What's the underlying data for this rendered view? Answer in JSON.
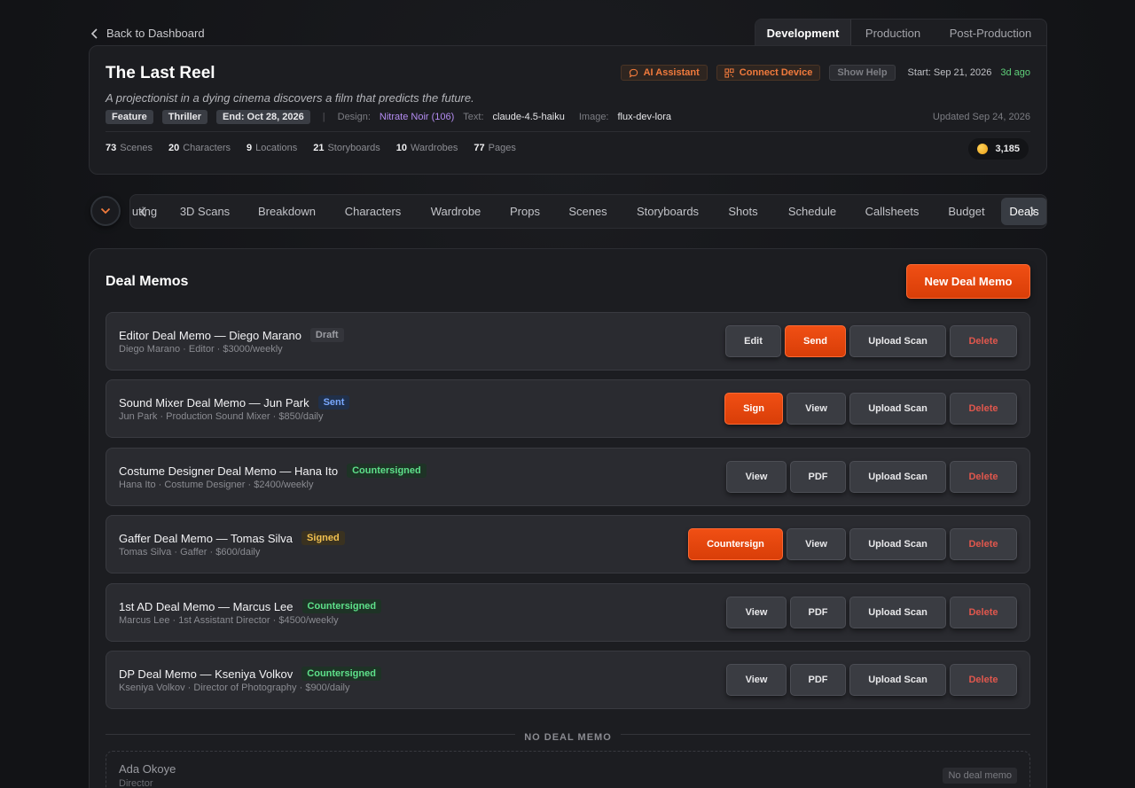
{
  "nav": {
    "back_label": "Back to Dashboard"
  },
  "phase_tabs": [
    {
      "label": "Development",
      "active": true
    },
    {
      "label": "Production",
      "active": false
    },
    {
      "label": "Post-Production",
      "active": false
    }
  ],
  "project": {
    "title": "The Last Reel",
    "logline": "A projectionist in a dying cinema discovers a film that predicts the future.",
    "tags": [
      "Feature",
      "Thriller",
      "End: Oct 28, 2026"
    ],
    "separator": "|",
    "design_label": "Design:",
    "design_value": "Nitrate Noir (106)",
    "text_label": "Text:",
    "text_value": "claude-4.5-haiku",
    "image_label": "Image:",
    "image_value": "flux-dev-lora",
    "updated": "Updated Sep 24, 2026",
    "ai_assistant_label": "AI Assistant",
    "connect_device_label": "Connect Device",
    "show_help_label": "Show Help",
    "start_date": "Start: Sep 21, 2026",
    "ago": "3d ago",
    "stats": [
      {
        "num": "73",
        "label": "Scenes"
      },
      {
        "num": "20",
        "label": "Characters"
      },
      {
        "num": "9",
        "label": "Locations"
      },
      {
        "num": "21",
        "label": "Storyboards"
      },
      {
        "num": "10",
        "label": "Wardrobes"
      },
      {
        "num": "77",
        "label": "Pages"
      }
    ],
    "credits": "3,185"
  },
  "section_tabs": [
    {
      "label": "uting",
      "active": false
    },
    {
      "label": "3D Scans",
      "active": false
    },
    {
      "label": "Breakdown",
      "active": false
    },
    {
      "label": "Characters",
      "active": false
    },
    {
      "label": "Wardrobe",
      "active": false
    },
    {
      "label": "Props",
      "active": false
    },
    {
      "label": "Scenes",
      "active": false
    },
    {
      "label": "Storyboards",
      "active": false
    },
    {
      "label": "Shots",
      "active": false
    },
    {
      "label": "Schedule",
      "active": false
    },
    {
      "label": "Callsheets",
      "active": false
    },
    {
      "label": "Budget",
      "active": false
    },
    {
      "label": "Deals",
      "active": true
    }
  ],
  "deal_memos": {
    "title": "Deal Memos",
    "new_button": "New Deal Memo",
    "items": [
      {
        "title": "Editor Deal Memo — Diego Marano",
        "status": "Draft",
        "status_kind": "draft",
        "subtitle": "Diego Marano · Editor · $3000/weekly",
        "actions": [
          {
            "label": "Edit",
            "kind": "default"
          },
          {
            "label": "Send",
            "kind": "primary"
          },
          {
            "label": "Upload Scan",
            "kind": "default"
          },
          {
            "label": "Delete",
            "kind": "danger"
          }
        ]
      },
      {
        "title": "Sound Mixer Deal Memo — Jun Park",
        "status": "Sent",
        "status_kind": "sent",
        "subtitle": "Jun Park · Production Sound Mixer · $850/daily",
        "actions": [
          {
            "label": "Sign",
            "kind": "primary"
          },
          {
            "label": "View",
            "kind": "default"
          },
          {
            "label": "Upload Scan",
            "kind": "default"
          },
          {
            "label": "Delete",
            "kind": "danger"
          }
        ]
      },
      {
        "title": "Costume Designer Deal Memo — Hana Ito",
        "status": "Countersigned",
        "status_kind": "countersigned",
        "subtitle": "Hana Ito · Costume Designer · $2400/weekly",
        "actions": [
          {
            "label": "View",
            "kind": "default"
          },
          {
            "label": "PDF",
            "kind": "default"
          },
          {
            "label": "Upload Scan",
            "kind": "default"
          },
          {
            "label": "Delete",
            "kind": "danger"
          }
        ]
      },
      {
        "title": "Gaffer Deal Memo — Tomas Silva",
        "status": "Signed",
        "status_kind": "signed",
        "subtitle": "Tomas Silva · Gaffer · $600/daily",
        "actions": [
          {
            "label": "Countersign",
            "kind": "primary"
          },
          {
            "label": "View",
            "kind": "default"
          },
          {
            "label": "Upload Scan",
            "kind": "default"
          },
          {
            "label": "Delete",
            "kind": "danger"
          }
        ]
      },
      {
        "title": "1st AD Deal Memo — Marcus Lee",
        "status": "Countersigned",
        "status_kind": "countersigned",
        "subtitle": "Marcus Lee · 1st Assistant Director · $4500/weekly",
        "actions": [
          {
            "label": "View",
            "kind": "default"
          },
          {
            "label": "PDF",
            "kind": "default"
          },
          {
            "label": "Upload Scan",
            "kind": "default"
          },
          {
            "label": "Delete",
            "kind": "danger"
          }
        ]
      },
      {
        "title": "DP Deal Memo — Kseniya Volkov",
        "status": "Countersigned",
        "status_kind": "countersigned",
        "subtitle": "Kseniya Volkov · Director of Photography · $900/daily",
        "actions": [
          {
            "label": "View",
            "kind": "default"
          },
          {
            "label": "PDF",
            "kind": "default"
          },
          {
            "label": "Upload Scan",
            "kind": "default"
          },
          {
            "label": "Delete",
            "kind": "danger"
          }
        ]
      }
    ],
    "no_deal_section": {
      "label": "NO DEAL MEMO",
      "items": [
        {
          "name": "Ada Okoye",
          "role": "Director",
          "badge": "No deal memo"
        }
      ]
    }
  },
  "colors": {
    "accent": "#e8470c",
    "background": "#121316",
    "card": "#1c1d21",
    "row": "#2a2b30",
    "success": "#5ee08a",
    "danger": "#e0574d"
  }
}
